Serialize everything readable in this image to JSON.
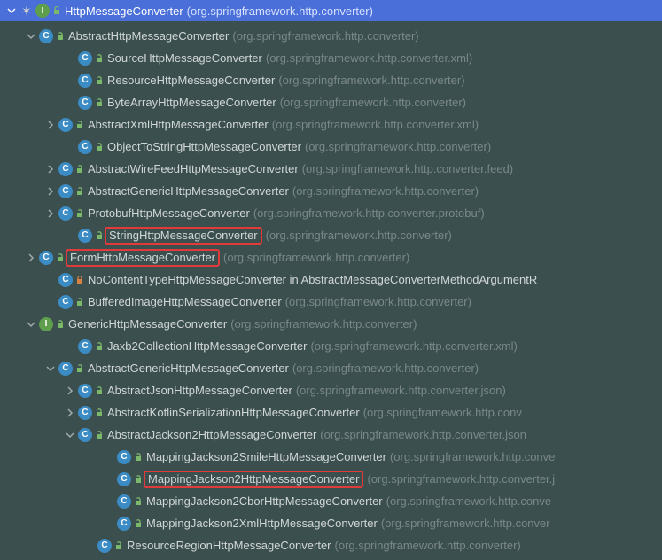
{
  "header": {
    "name": "HttpMessageConverter",
    "pkg": "(org.springframework.http.converter)"
  },
  "nodes": [
    {
      "indent": 1,
      "arrow": "down",
      "icons": [
        "C",
        "unlock"
      ],
      "name": "AbstractHttpMessageConverter",
      "pkg": "(org.springframework.http.converter)"
    },
    {
      "indent": 3,
      "arrow": "",
      "icons": [
        "C",
        "unlock"
      ],
      "name": "SourceHttpMessageConverter",
      "pkg": "(org.springframework.http.converter.xml)"
    },
    {
      "indent": 3,
      "arrow": "",
      "icons": [
        "C",
        "unlock"
      ],
      "name": "ResourceHttpMessageConverter",
      "pkg": "(org.springframework.http.converter)"
    },
    {
      "indent": 3,
      "arrow": "",
      "icons": [
        "C",
        "unlock"
      ],
      "name": "ByteArrayHttpMessageConverter",
      "pkg": "(org.springframework.http.converter)"
    },
    {
      "indent": 2,
      "arrow": "right",
      "icons": [
        "C",
        "unlock"
      ],
      "name": "AbstractXmlHttpMessageConverter",
      "pkg": "(org.springframework.http.converter.xml)"
    },
    {
      "indent": 3,
      "arrow": "",
      "icons": [
        "C",
        "unlock"
      ],
      "name": "ObjectToStringHttpMessageConverter",
      "pkg": "(org.springframework.http.converter)"
    },
    {
      "indent": 2,
      "arrow": "right",
      "icons": [
        "C",
        "unlock"
      ],
      "name": "AbstractWireFeedHttpMessageConverter",
      "pkg": "(org.springframework.http.converter.feed)"
    },
    {
      "indent": 2,
      "arrow": "right",
      "icons": [
        "C",
        "unlock"
      ],
      "name": "AbstractGenericHttpMessageConverter",
      "pkg": "(org.springframework.http.converter)"
    },
    {
      "indent": 2,
      "arrow": "right",
      "icons": [
        "C",
        "unlock"
      ],
      "name": "ProtobufHttpMessageConverter",
      "pkg": "(org.springframework.http.converter.protobuf)"
    },
    {
      "indent": 3,
      "arrow": "",
      "icons": [
        "C",
        "unlock"
      ],
      "name": "StringHttpMessageConverter",
      "pkg": "(org.springframework.http.converter)",
      "hl": true
    },
    {
      "indent": 1,
      "arrow": "right",
      "icons": [
        "C",
        "unlock"
      ],
      "name": "FormHttpMessageConverter",
      "pkg": "(org.springframework.http.converter)",
      "hl": true
    },
    {
      "indent": 2,
      "arrow": "",
      "icons": [
        "C",
        "lock"
      ],
      "name": "NoContentTypeHttpMessageConverter in AbstractMessageConverterMethodArgumentR",
      "pkg": ""
    },
    {
      "indent": 2,
      "arrow": "",
      "icons": [
        "C",
        "unlock"
      ],
      "name": "BufferedImageHttpMessageConverter",
      "pkg": "(org.springframework.http.converter)"
    },
    {
      "indent": 1,
      "arrow": "down",
      "icons": [
        "I",
        "unlock"
      ],
      "name": "GenericHttpMessageConverter",
      "pkg": "(org.springframework.http.converter)"
    },
    {
      "indent": 3,
      "arrow": "",
      "icons": [
        "C",
        "unlock"
      ],
      "name": "Jaxb2CollectionHttpMessageConverter",
      "pkg": "(org.springframework.http.converter.xml)"
    },
    {
      "indent": 2,
      "arrow": "down",
      "icons": [
        "C",
        "unlock"
      ],
      "name": "AbstractGenericHttpMessageConverter",
      "pkg": "(org.springframework.http.converter)"
    },
    {
      "indent": 3,
      "arrow": "right",
      "icons": [
        "C",
        "unlock"
      ],
      "name": "AbstractJsonHttpMessageConverter",
      "pkg": "(org.springframework.http.converter.json)"
    },
    {
      "indent": 3,
      "arrow": "right",
      "icons": [
        "C",
        "unlock"
      ],
      "name": "AbstractKotlinSerializationHttpMessageConverter",
      "pkg": "(org.springframework.http.conv"
    },
    {
      "indent": 3,
      "arrow": "down",
      "icons": [
        "C",
        "unlock"
      ],
      "name": "AbstractJackson2HttpMessageConverter",
      "pkg": "(org.springframework.http.converter.json"
    },
    {
      "indent": 5,
      "arrow": "",
      "icons": [
        "C",
        "unlock"
      ],
      "name": "MappingJackson2SmileHttpMessageConverter",
      "pkg": "(org.springframework.http.conve"
    },
    {
      "indent": 5,
      "arrow": "",
      "icons": [
        "C",
        "unlock"
      ],
      "name": "MappingJackson2HttpMessageConverter",
      "pkg": "(org.springframework.http.converter.j",
      "hl": true
    },
    {
      "indent": 5,
      "arrow": "",
      "icons": [
        "C",
        "unlock"
      ],
      "name": "MappingJackson2CborHttpMessageConverter",
      "pkg": "(org.springframework.http.conve"
    },
    {
      "indent": 5,
      "arrow": "",
      "icons": [
        "C",
        "unlock"
      ],
      "name": "MappingJackson2XmlHttpMessageConverter",
      "pkg": "(org.springframework.http.conver"
    },
    {
      "indent": 4,
      "arrow": "",
      "icons": [
        "C",
        "unlock"
      ],
      "name": "ResourceRegionHttpMessageConverter",
      "pkg": "(org.springframework.http.converter)"
    }
  ]
}
